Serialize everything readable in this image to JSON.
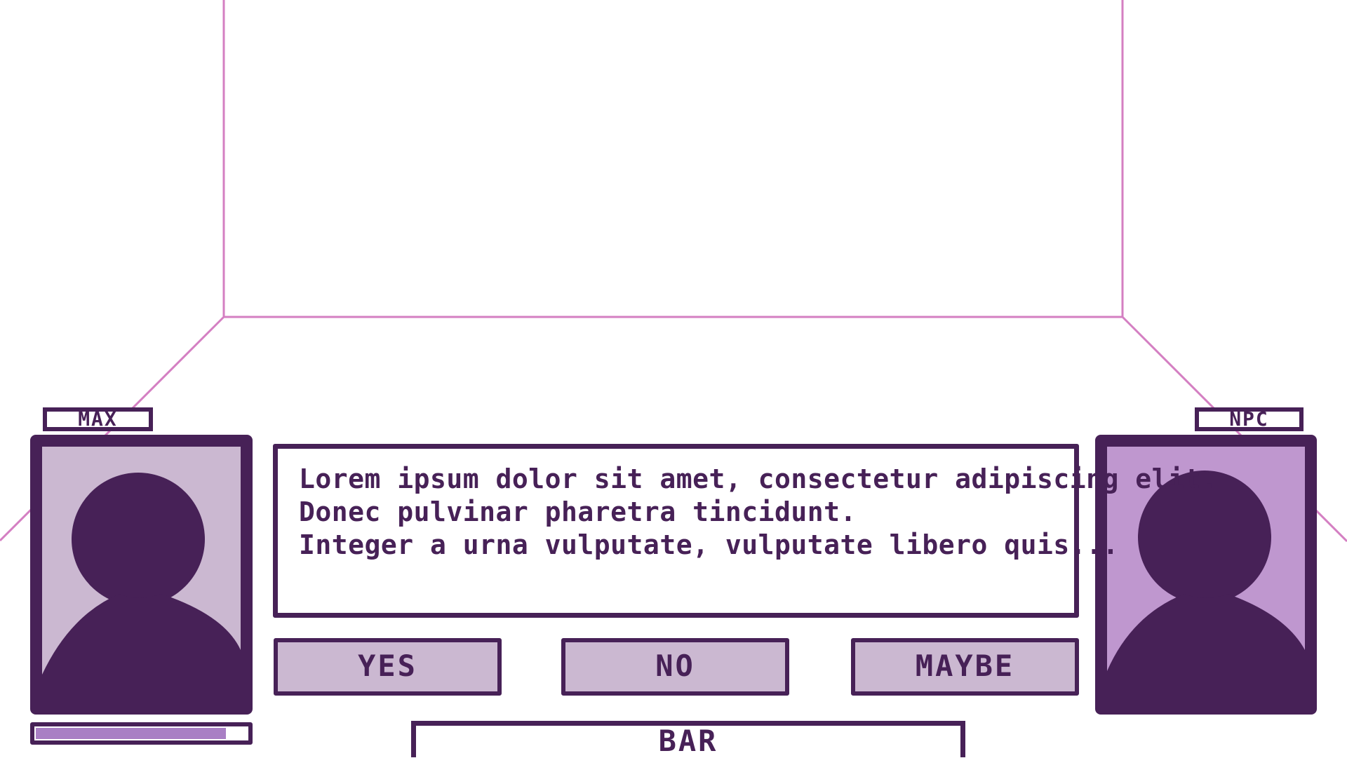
{
  "colors": {
    "ink": "#472157",
    "room_lines": "#d47fc2",
    "button_fill": "#cbb8d1",
    "player_portrait_bg": "#cbb8d1",
    "npc_portrait_bg": "#bf97cf",
    "health_fill": "#a97fc4"
  },
  "player": {
    "name": "MAX",
    "health_fraction": 0.9,
    "portrait_icon": "silhouette-icon"
  },
  "npc": {
    "name": "NPC",
    "portrait_icon": "silhouette-icon"
  },
  "dialog": {
    "lines": [
      "Lorem ipsum dolor sit amet, consectetur adipiscing elit.",
      "Donec pulvinar pharetra tincidunt.",
      "Integer a urna vulputate, vulputate libero quis..."
    ]
  },
  "choices": [
    {
      "label": "YES"
    },
    {
      "label": "NO"
    },
    {
      "label": "MAYBE"
    }
  ],
  "bottom_bar": {
    "label": "BAR"
  }
}
